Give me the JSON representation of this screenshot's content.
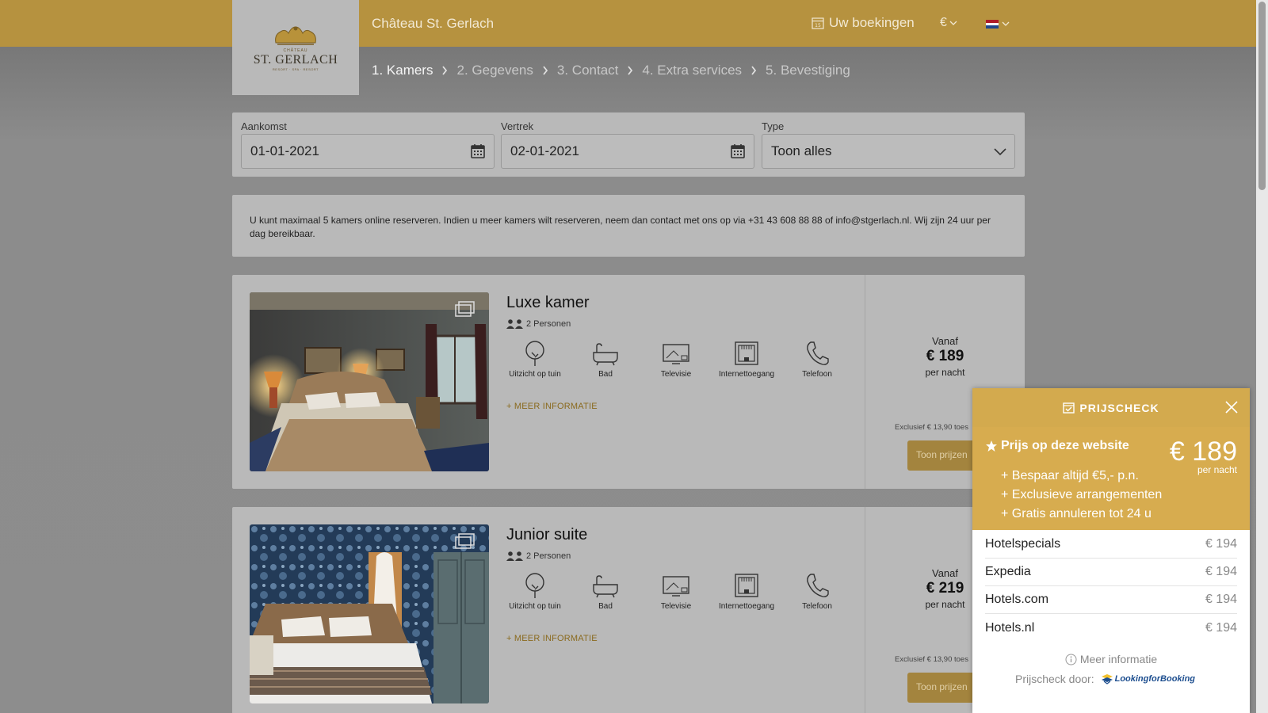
{
  "header": {
    "hotel_name": "Château St. Gerlach",
    "bookings_label": "Uw boekingen",
    "currency": "€",
    "logo": {
      "line1": "CHÂTEAU",
      "name": "ST. GERLACH",
      "tagline": "RESORT · SPA · RESORT"
    }
  },
  "steps": [
    {
      "label": "1. Kamers",
      "active": true
    },
    {
      "label": "2. Gegevens",
      "active": false
    },
    {
      "label": "3. Contact",
      "active": false
    },
    {
      "label": "4. Extra services",
      "active": false
    },
    {
      "label": "5. Bevestiging",
      "active": false
    }
  ],
  "search": {
    "arrival_label": "Aankomst",
    "arrival_value": "01-01-2021",
    "departure_label": "Vertrek",
    "departure_value": "02-01-2021",
    "type_label": "Type",
    "type_value": "Toon alles"
  },
  "notice": "U kunt maximaal 5 kamers online reserveren. Indien u meer kamers wilt reserveren, neem dan contact met ons op via +31 43 608 88 88 of info@stgerlach.nl. Wij zijn 24 uur per dag bereikbaar.",
  "amenities": [
    "Uitzicht op tuin",
    "Bad",
    "Televisie",
    "Internettoegang",
    "Telefoon"
  ],
  "rooms": [
    {
      "title": "Luxe kamer",
      "persons": "2 Personen",
      "more_info": "+ MEER INFORMATIE",
      "from_label": "Vanaf",
      "price": "€ 189",
      "per_night": "per nacht",
      "excl": "Exclusief € 13,90 toes",
      "button": "Toon prijzen"
    },
    {
      "title": "Junior suite",
      "persons": "2 Personen",
      "more_info": "+ MEER INFORMATIE",
      "from_label": "Vanaf",
      "price": "€ 219",
      "per_night": "per nacht",
      "excl": "Exclusief € 13,90 toes",
      "button": "Toon prijzen"
    }
  ],
  "pricecheck": {
    "title": "PRIJSCHECK",
    "site_label": "Prijs op deze website",
    "site_price": "€ 189",
    "per_night": "per nacht",
    "benefits": [
      "+ Bespaar altijd €5,- p.n.",
      "+ Exclusieve arrangementen",
      "+ Gratis annuleren tot 24 u"
    ],
    "competitors": [
      {
        "name": "Hotelspecials",
        "price": "€ 194"
      },
      {
        "name": "Expedia",
        "price": "€ 194"
      },
      {
        "name": "Hotels.com",
        "price": "€ 194"
      },
      {
        "name": "Hotels.nl",
        "price": "€ 194"
      }
    ],
    "more_info": "Meer informatie",
    "powered_by": "Prijscheck door:",
    "provider": "LookingforBooking"
  },
  "colors": {
    "brand_gold": "#b6923f",
    "popup_gold": "#d7ac4f",
    "link": "#8a6a1e"
  }
}
